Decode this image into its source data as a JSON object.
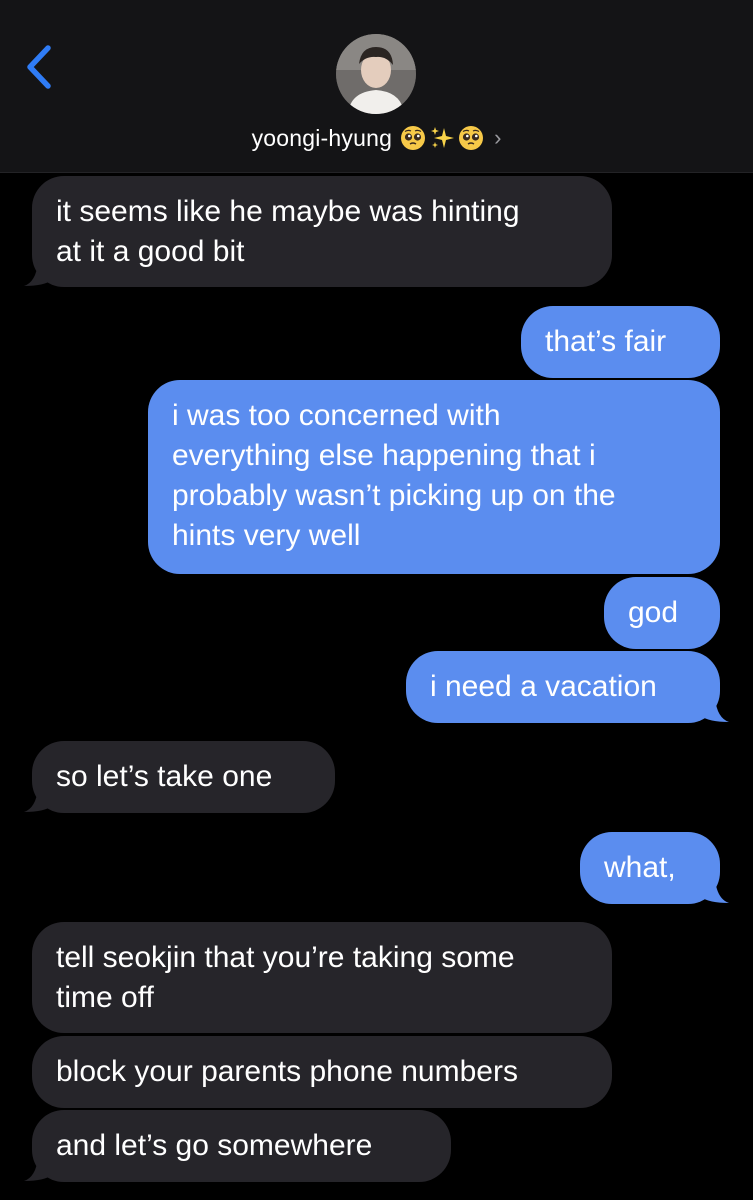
{
  "header": {
    "contact_name": "yoongi-hyung",
    "emoji_icons": [
      "pleading-face-icon",
      "sparkles-icon",
      "pleading-face-icon"
    ],
    "chevron": "›"
  },
  "colors": {
    "incoming_bubble": "#26252a",
    "outgoing_bubble": "#5b8def",
    "accent": "#2f7cf6",
    "background": "#000000"
  },
  "messages": [
    {
      "direction": "incoming",
      "text": "it seems like he maybe was hinting\nat it a good bit"
    },
    {
      "direction": "outgoing",
      "text": "that’s fair"
    },
    {
      "direction": "outgoing",
      "text": "i was too concerned with\neverything else happening that i\nprobably wasn’t picking up on the\nhints very well"
    },
    {
      "direction": "outgoing",
      "text": "god"
    },
    {
      "direction": "outgoing",
      "text": "i need a vacation"
    },
    {
      "direction": "incoming",
      "text": "so let’s take one"
    },
    {
      "direction": "outgoing",
      "text": "what,"
    },
    {
      "direction": "incoming",
      "text": "tell seokjin that you’re taking some\ntime off"
    },
    {
      "direction": "incoming",
      "text": "block your parents phone numbers"
    },
    {
      "direction": "incoming",
      "text": "and let’s go somewhere"
    }
  ]
}
